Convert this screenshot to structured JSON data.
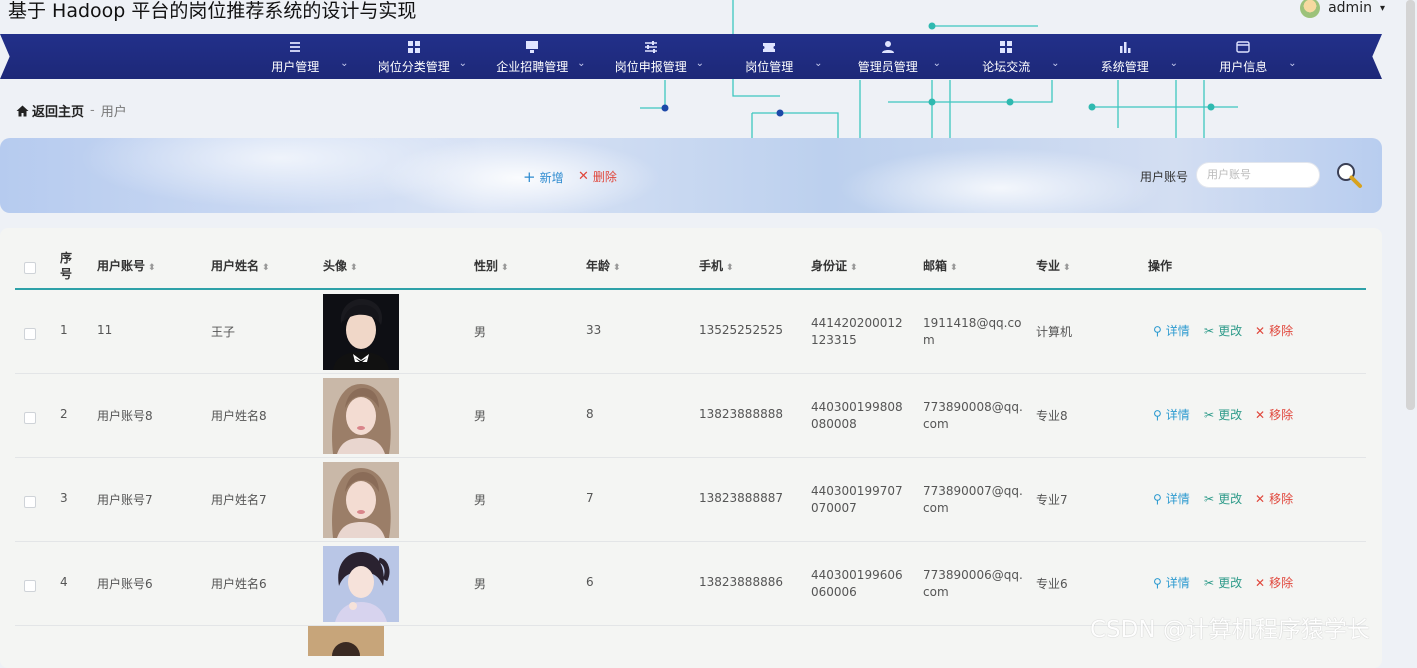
{
  "site_title": "基于 Hadoop 平台的岗位推荐系统的设计与实现",
  "user": {
    "name": "admin",
    "caret": "▾"
  },
  "nav": [
    {
      "label": "用户管理",
      "icon": "list-icon"
    },
    {
      "label": "岗位分类管理",
      "icon": "grid-icon"
    },
    {
      "label": "企业招聘管理",
      "icon": "monitor-icon"
    },
    {
      "label": "岗位申报管理",
      "icon": "sliders-icon"
    },
    {
      "label": "岗位管理",
      "icon": "ticket-icon"
    },
    {
      "label": "管理员管理",
      "icon": "user-icon"
    },
    {
      "label": "论坛交流",
      "icon": "grid-icon"
    },
    {
      "label": "系统管理",
      "icon": "bar-chart-icon"
    },
    {
      "label": "用户信息",
      "icon": "card-icon"
    }
  ],
  "breadcrumb": {
    "home": "返回主页",
    "sep": "-",
    "current": "用户"
  },
  "toolbar": {
    "add_label": "新增",
    "add_icon": "+",
    "delete_label": "删除",
    "delete_icon": "✕",
    "search_label": "用户账号",
    "search_placeholder": "用户账号",
    "search_value": ""
  },
  "table": {
    "headers": {
      "index": "序号",
      "account": "用户账号",
      "name": "用户姓名",
      "avatar": "头像",
      "gender": "性别",
      "age": "年龄",
      "phone": "手机",
      "idcard": "身份证",
      "email": "邮箱",
      "major": "专业",
      "ops": "操作"
    },
    "sort_glyph": "⬍",
    "actions": {
      "detail": "详情",
      "edit": "更改",
      "remove": "移除"
    },
    "rows": [
      {
        "index": "1",
        "account": "11",
        "name": "王子",
        "gender": "男",
        "age": "33",
        "phone": "13525252525",
        "idcard": "441420200012123315",
        "email": "1911418@qq.com",
        "major": "计算机",
        "photo": "man-tuxedo"
      },
      {
        "index": "2",
        "account": "用户账号8",
        "name": "用户姓名8",
        "gender": "男",
        "age": "8",
        "phone": "13823888888",
        "idcard": "440300199808080008",
        "email": "773890008@qq.com",
        "major": "专业8",
        "photo": "woman-1"
      },
      {
        "index": "3",
        "account": "用户账号7",
        "name": "用户姓名7",
        "gender": "男",
        "age": "7",
        "phone": "13823888887",
        "idcard": "440300199707070007",
        "email": "773890007@qq.com",
        "major": "专业7",
        "photo": "woman-1"
      },
      {
        "index": "4",
        "account": "用户账号6",
        "name": "用户姓名6",
        "gender": "男",
        "age": "6",
        "phone": "13823888886",
        "idcard": "440300199606060006",
        "email": "773890006@qq.com",
        "major": "专业6",
        "photo": "woman-2"
      }
    ]
  },
  "watermark": "CSDN @计算机程序猿学长",
  "colors": {
    "nav": "#1f2c82",
    "accent": "#2ea1a8",
    "danger": "#e0473c",
    "info": "#2e9bd0"
  }
}
